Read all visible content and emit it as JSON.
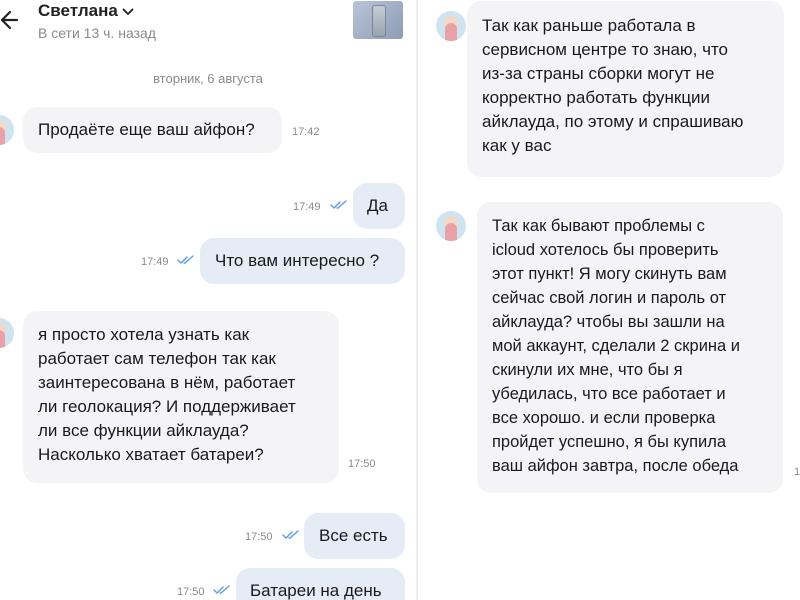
{
  "header": {
    "contact_name": "Светлана",
    "status": "В сети 13 ч. назад"
  },
  "date_separator": "вторник, 6 августа",
  "messages": [
    {
      "direction": "in",
      "text": "Продаёте еще ваш айфон?",
      "time": "17:42"
    },
    {
      "direction": "out",
      "text": "Да",
      "time": "17:49",
      "read": true
    },
    {
      "direction": "out",
      "text": "Что вам интересно ?",
      "time": "17:49",
      "read": true
    },
    {
      "direction": "in",
      "lines": [
        "я просто хотела узнать как",
        "работает сам телефон так как",
        "заинтересована в нём, работает",
        "ли геолокация? И поддерживает",
        "ли все функции айклауда?",
        "Насколько хватает батареи?"
      ],
      "time": "17:50"
    },
    {
      "direction": "out",
      "text": "Все есть",
      "time": "17:50",
      "read": true
    },
    {
      "direction": "out",
      "text": "Батареи на день",
      "time": "17:50",
      "read": true
    },
    {
      "direction": "in",
      "lines": [
        "Так как раньше работала в",
        "сервисном центре то знаю, что",
        "из-за страны сборки могут не",
        "корректно работать функции",
        "айклауда, по этому и спрашиваю",
        "как у вас"
      ]
    },
    {
      "direction": "in",
      "lines": [
        "Так как бывают проблемы с",
        "icloud хотелось бы проверить",
        "этот пункт! Я могу скинуть вам",
        "сейчас свой логин и пароль от",
        "айклауда? чтобы вы зашли на",
        "мой аккаунт, сделали 2 скрина и",
        "скинули их мне, что бы я",
        "убедилась, что все работает  и",
        "все хорошо.  и если проверка",
        "пройдет успешно, я бы купила",
        "ваш айфон завтра, после обеда"
      ],
      "time": "1"
    }
  ],
  "colors": {
    "bubble_in": "#f4f4f6",
    "bubble_out": "#e5ecf6",
    "read_ticks": "#5a9be6",
    "meta_text": "#8a8a8a"
  },
  "icons": [
    "back-arrow-icon",
    "chevron-down-icon",
    "read-ticks-icon",
    "avatar"
  ]
}
